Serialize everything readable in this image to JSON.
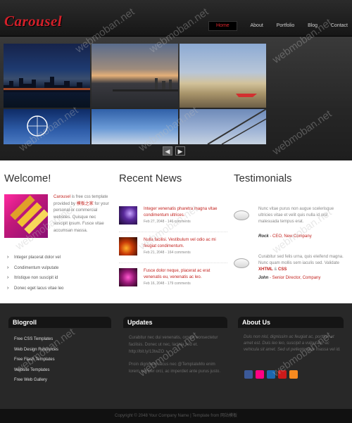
{
  "header": {
    "logo": "Carousel",
    "nav": [
      "Home",
      "About",
      "Portfolio",
      "Blog",
      "Contact"
    ]
  },
  "banner": {
    "prev_icon": "arrow-left-icon",
    "next_icon": "arrow-right-icon"
  },
  "welcome": {
    "title": "Welcome!",
    "brand": "Carousel",
    "t1": " is free css template provided by ",
    "link": "模板之家",
    "t2": " for your personal or commercial websites. Quisque nec suscipit ipsum. Fusce vitae accumsan massa.",
    "bullets": [
      "Integer placerat dolor vel",
      "Condimentum vulputate",
      "Itristique non suscipit id",
      "Donec eget lacus vitae leo"
    ]
  },
  "news": {
    "title": "Recent News",
    "items": [
      {
        "title": "Integer venenatis pharetra magna vitae condimentum ultrices.",
        "date": "Feb 27, 2048",
        "comments": "146 comments"
      },
      {
        "title": "Nulla facilisi. Vestibulum vel odio ac mi feugiat condimentum.",
        "date": "Feb 21, 2048",
        "comments": "164 comments"
      },
      {
        "title": "Fusce dolor neque, placerat ac erat venenatis eu, venenatis ac leo.",
        "date": "Feb 16, 2048",
        "comments": "179 comments"
      }
    ]
  },
  "testimonials": {
    "title": "Testimonials",
    "items": [
      {
        "quote": "Nunc vitae purus non augue scelerisque ultricies vitae et velit quis nulla id orci malesuada tempus erat.",
        "name": "Rock",
        "role": " - CEO, New Company"
      },
      {
        "quote_a": "Curabitur sed felis urna, quis eleifend magna. Nunc quam mollis sem iaculis sed. Validate ",
        "xhtml": "XHTML",
        "amp": " & ",
        "css": "CSS",
        "name": "John",
        "role": " - Senior Director, Company"
      }
    ]
  },
  "footer": {
    "blogroll_title": "Blogroll",
    "blogroll": [
      "Free CSS Templates",
      "Web Design Resources",
      "Free Flash Templates",
      "Website Templates",
      "Free Web Gallery"
    ],
    "updates_title": "Updates",
    "updates_1": "Curabitur nec dui venenatis, ornare consectetur facilisis. Donec ut nec, lacinia sed et. http://bit.ly/13twZO",
    "updates_2": "Proin dignissim lacus nec @TemplateMo enim lorem semper orci, ac imperdiet ante purus justo.",
    "about_title": "About Us",
    "about": "Duis non nisl, dignissim ac feugiat ac, porttitor et amet est. Duis leo leo, suscipit a vulputate, ac vehicula sit amet. Sed ut pellentesque massa vel id.",
    "socials": [
      "facebook-icon",
      "flickr-icon",
      "digg-icon",
      "youtube-icon",
      "rss-icon"
    ],
    "social_colors": [
      "#3b5998",
      "#ff0084",
      "#1c68b0",
      "#cc1a1a",
      "#f68a1f"
    ]
  },
  "copyright": "Copyright © 2048 Your Company Name | Template from 网站模板",
  "watermark": "webmoban.net"
}
